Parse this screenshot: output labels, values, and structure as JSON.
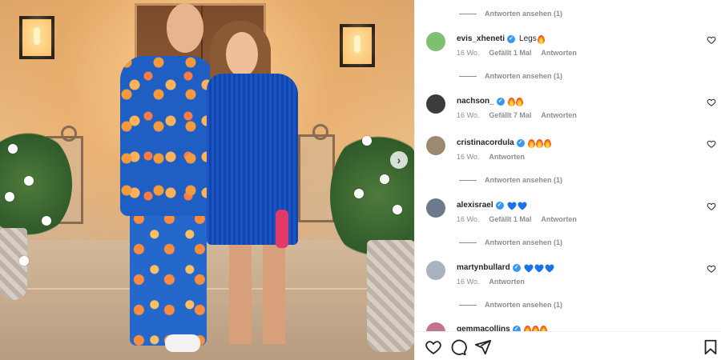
{
  "photo": {
    "next_icon": "chevron-right-icon"
  },
  "comments": [
    {
      "id": "evis",
      "username": "evis_xheneti",
      "verified": true,
      "text": "Legs",
      "emoji": [
        "fire"
      ],
      "time": "16 Wo.",
      "likes": "Gefällt 1 Mal",
      "reply": "Antworten",
      "view_replies": "Antworten ansehen (1)"
    },
    {
      "id": "nachson",
      "username": "nachson_",
      "verified": true,
      "text": "",
      "emoji": [
        "fire",
        "fire"
      ],
      "time": "16 Wo.",
      "likes": "Gefällt 7 Mal",
      "reply": "Antworten",
      "view_replies": ""
    },
    {
      "id": "cristina",
      "username": "cristinacordula",
      "verified": true,
      "text": "",
      "emoji": [
        "fire",
        "fire",
        "fire"
      ],
      "time": "16 Wo.",
      "likes": "",
      "reply": "Antworten",
      "view_replies": "Antworten ansehen (1)"
    },
    {
      "id": "alexis",
      "username": "alexisrael",
      "verified": true,
      "text": "",
      "emoji": [
        "blue-heart",
        "blue-heart"
      ],
      "time": "16 Wo.",
      "likes": "Gefällt 1 Mal",
      "reply": "Antworten",
      "view_replies": "Antworten ansehen (1)"
    },
    {
      "id": "martyn",
      "username": "martynbullard",
      "verified": true,
      "text": "",
      "emoji": [
        "blue-heart",
        "blue-heart",
        "blue-heart"
      ],
      "time": "16 Wo.",
      "likes": "",
      "reply": "Antworten",
      "view_replies": "Antworten ansehen (1)"
    }
  ],
  "top_view_replies": "Antworten ansehen (1)",
  "partial_comment": {
    "username": "gemmacollins"
  },
  "actions": {
    "like_icon": "heart-outline-icon",
    "comment_icon": "comment-bubble-icon",
    "share_icon": "paper-plane-icon",
    "save_icon": "bookmark-icon"
  },
  "colors": {
    "verified": "#3897f0",
    "secondary_text": "#8e8e8e",
    "blue_heart": "#1a73e8"
  }
}
